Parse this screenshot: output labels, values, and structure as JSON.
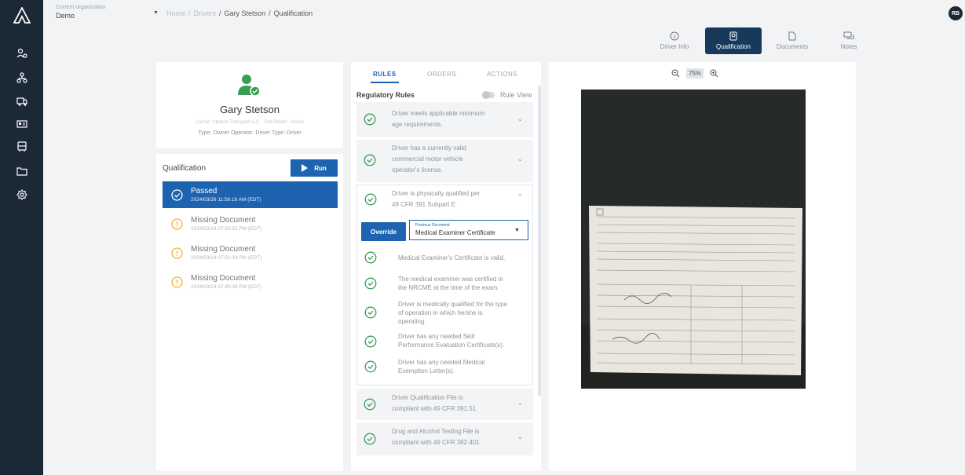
{
  "header": {
    "org_label": "Current organization",
    "org_name": "Demo",
    "breadcrumb": [
      "Home",
      "Drivers",
      "Gary Stetson",
      "Qualification"
    ],
    "avatar": "RB"
  },
  "top_tabs": [
    {
      "label": "Driver Info",
      "icon": "info-icon"
    },
    {
      "label": "Qualification",
      "icon": "qualification-icon",
      "active": true
    },
    {
      "label": "Documents",
      "icon": "document-icon"
    },
    {
      "label": "Notes",
      "icon": "notes-icon"
    }
  ],
  "profile": {
    "name": "Gary Stetson",
    "meta": "Carrier: Stetson Transport LLC · Cell Report · Active",
    "type": "Type: Owner Operator",
    "driver_type": "Driver Type: Driver"
  },
  "qualification": {
    "title": "Qualification",
    "run_label": "Run",
    "runs": [
      {
        "status": "Passed",
        "timestamp": "2024/03/26 11:56:18 AM (EDT)"
      },
      {
        "status": "Missing Document",
        "timestamp": "2024/03/24 07:53:52 PM (EDT)"
      },
      {
        "status": "Missing Document",
        "timestamp": "2024/03/24 07:51:19 PM (EDT)"
      },
      {
        "status": "Missing Document",
        "timestamp": "2024/03/24 07:49:39 PM (EDT)"
      }
    ]
  },
  "rules_panel": {
    "tabs": [
      "RULES",
      "ORDERS",
      "ACTIONS"
    ],
    "title": "Regulatory Rules",
    "toggle_label": "Rule View",
    "rules": [
      {
        "lines": [
          "Driver meets applicable minimum",
          "age requirements."
        ]
      },
      {
        "lines": [
          "Driver has a currently valid",
          "commercial motor vehicle",
          "operator's license."
        ]
      },
      {
        "lines": [
          "Driver is physically qualified per",
          "49 CFR 391 Subpart E."
        ]
      },
      {
        "lines": [
          "Driver Qualification File is",
          "compliant with 49 CFR 391.51."
        ]
      },
      {
        "lines": [
          "Drug and Alcohol Testing File is",
          "compliant with 49 CFR 382.401."
        ]
      }
    ],
    "override_label": "Override",
    "previous_document_label": "Previous Document",
    "previous_document_value": "Medical Examiner Certificate",
    "subrules": [
      {
        "lines": [
          "Medical Examiner's Certificate is valid."
        ]
      },
      {
        "lines": [
          "The medical examiner was certified in",
          "the NRCME at the time of the exam."
        ]
      },
      {
        "lines": [
          "Driver is medically qualified for the type",
          "of operation in which he/she is",
          "operating."
        ]
      },
      {
        "lines": [
          "Driver has any needed Skill",
          "Performance Evaluation Certificate(s)."
        ]
      },
      {
        "lines": [
          "Driver has any needed Medical",
          "Exemption Letter(s)."
        ]
      }
    ]
  },
  "viewer": {
    "zoom": "75%"
  },
  "colors": {
    "sidebar": "#1b2836",
    "primary": "#1e63b0",
    "active_tab": "#173a5c",
    "success": "#3a9d56",
    "warning": "#f0b429"
  }
}
